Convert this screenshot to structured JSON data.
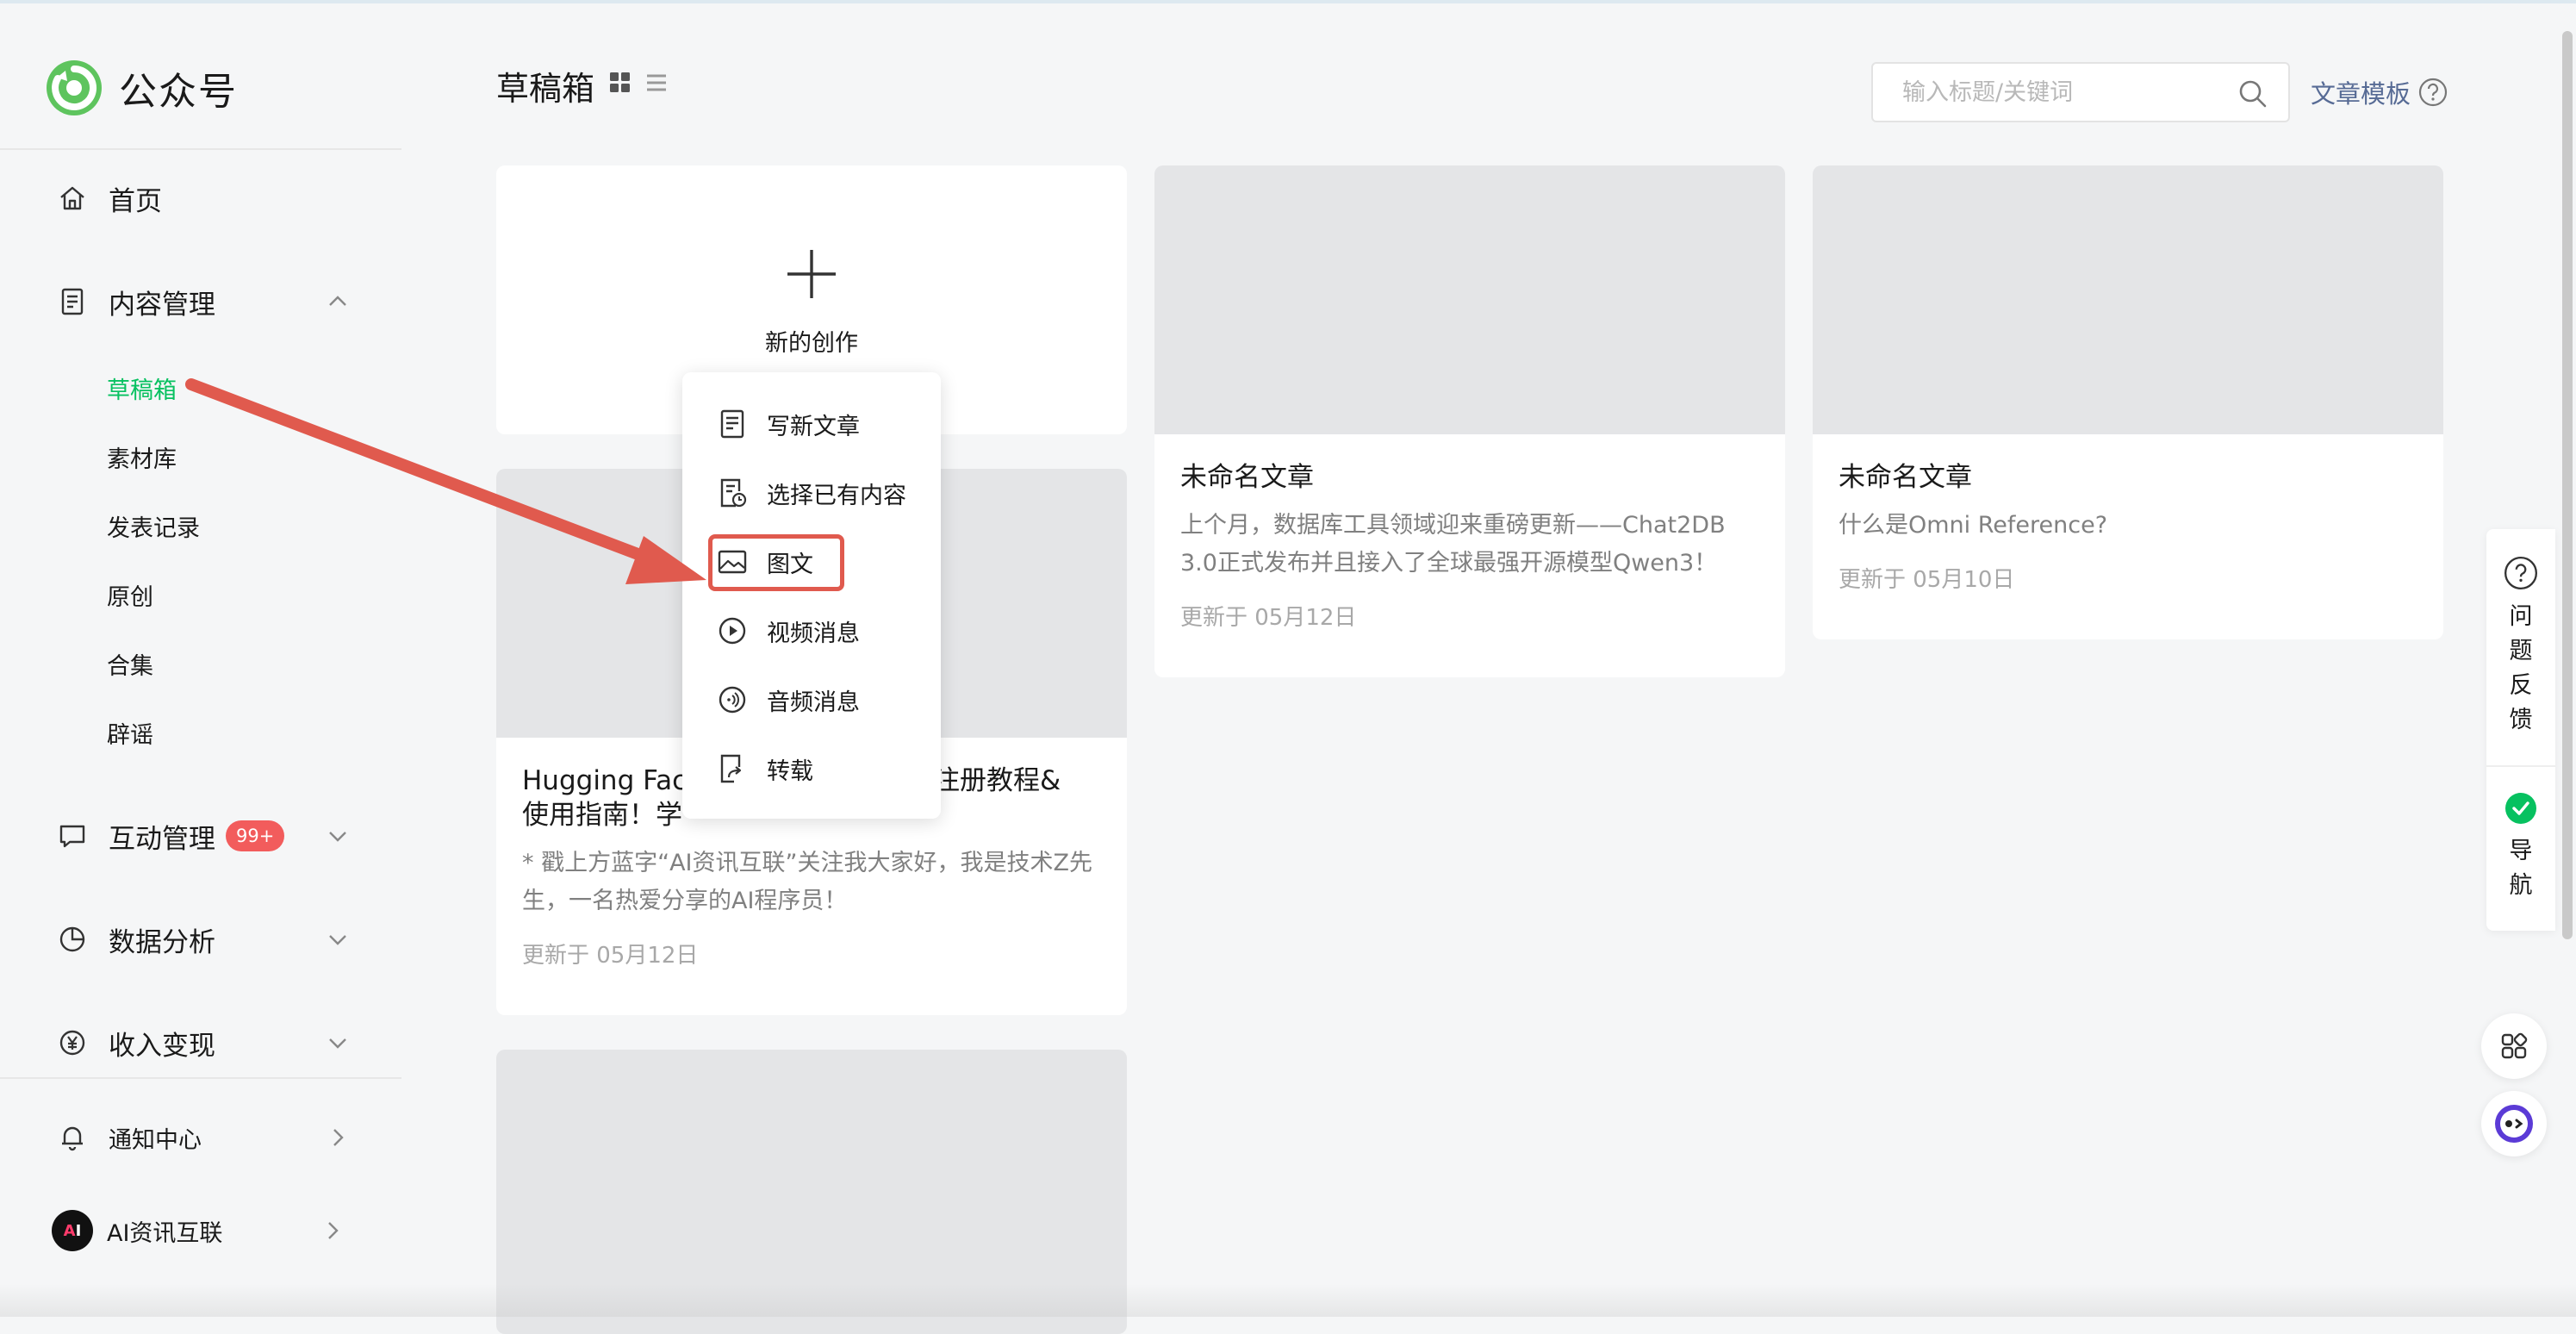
{
  "app": {
    "name": "公众号"
  },
  "sidebar": {
    "home": "首页",
    "content_mgmt": "内容管理",
    "sub_items": [
      "草稿箱",
      "素材库",
      "发表记录",
      "原创",
      "合集",
      "辟谣"
    ],
    "interaction_mgmt": "互动管理",
    "interaction_badge": "99+",
    "data_analysis": "数据分析",
    "monetization": "收入变现",
    "notifications": "通知中心",
    "account": "AI资讯互联",
    "avatar_text_a": "A",
    "avatar_text_i": "I"
  },
  "header": {
    "title": "草稿箱",
    "search_placeholder": "输入标题/关键词",
    "template_link": "文章模板"
  },
  "new_card": {
    "label": "新的创作"
  },
  "popup_menu": {
    "items": [
      "写新文章",
      "选择已有内容",
      "图文",
      "视频消息",
      "音频消息",
      "转载"
    ],
    "highlighted": "图文"
  },
  "cards": [
    {
      "title": "Hugging Fac",
      "title_tail": "内注册教程&",
      "title_line2": "使用指南！学",
      "desc": "* 戳上方蓝字“AI资讯互联”关注我大家好，我是技术Z先生，一名热爱分享的AI程序员！",
      "date": "更新于 05月12日"
    },
    {
      "title": "未命名文章",
      "desc": "上个月，数据库工具领域迎来重磅更新——Chat2DB 3.0正式发布并且接入了全球最强开源模型Qwen3！",
      "date": "更新于 05月12日"
    },
    {
      "title": "未命名文章",
      "desc": "什么是Omni Reference?",
      "date": "更新于 05月10日"
    }
  ],
  "right_panel": {
    "feedback": "问题反馈",
    "nav": "导航"
  },
  "colors": {
    "accent_green": "#07c160",
    "link_blue": "#576b95",
    "badge_red": "#f25c5c",
    "annotation_red": "#e05a4e"
  }
}
